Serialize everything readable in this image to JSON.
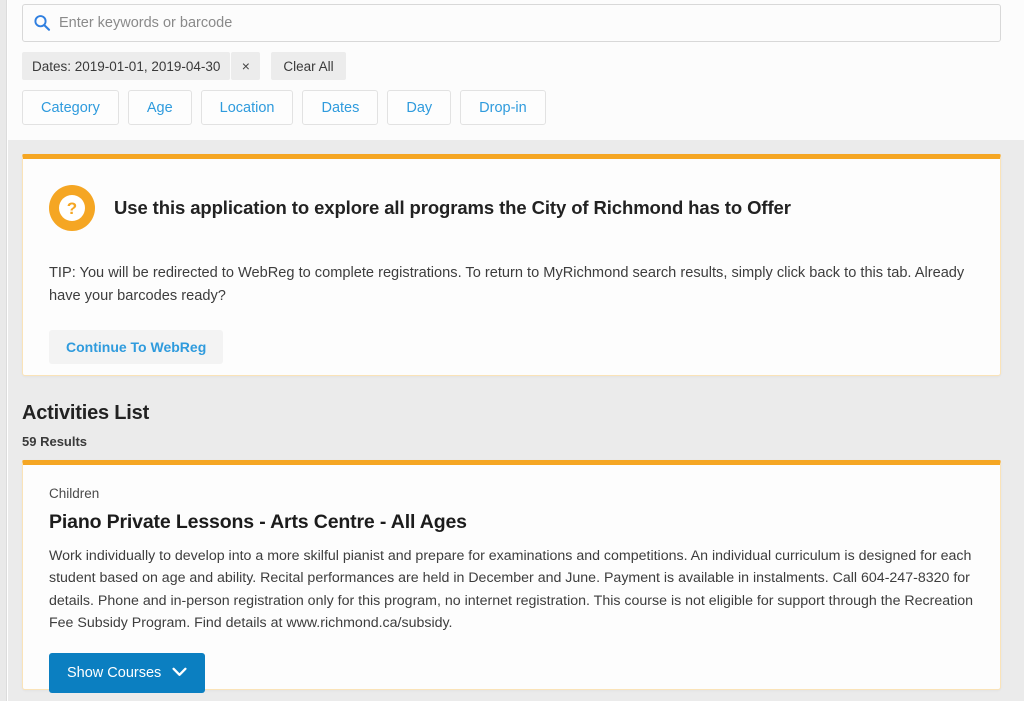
{
  "search": {
    "placeholder": "Enter keywords or barcode",
    "value": "",
    "icon": "search-icon"
  },
  "active_filters": {
    "chip_label": "Dates: 2019-01-01, 2019-04-30",
    "remove_icon": "×",
    "clear_all_label": "Clear All"
  },
  "filter_buttons": [
    {
      "label": "Category"
    },
    {
      "label": "Age"
    },
    {
      "label": "Location"
    },
    {
      "label": "Dates"
    },
    {
      "label": "Day"
    },
    {
      "label": "Drop-in"
    }
  ],
  "info_card": {
    "badge_icon": "question-mark-icon",
    "badge_glyph": "?",
    "title": "Use this application to explore all programs the City of Richmond has to Offer",
    "tip": "TIP: You will be redirected to WebReg to complete registrations. To return to MyRichmond search results, simply click back to this tab. Already have your barcodes ready?",
    "button_label": "Continue To WebReg"
  },
  "activities": {
    "heading": "Activities List",
    "results_count": "59 Results",
    "items": [
      {
        "category": "Children",
        "title": "Piano Private Lessons - Arts Centre - All Ages",
        "description": "Work individually to develop into a more skilful pianist and prepare for examinations and competitions. An individual curriculum is designed for each student based on age and ability. Recital performances are held in December and June. Payment is available in instalments. Call 604-247-8320 for details. Phone and in-person registration only for this program, no internet registration. This course is not eligible for support through the Recreation Fee Subsidy Program. Find details at www.richmond.ca/subsidy.",
        "action_label": "Show Courses",
        "action_icon": "chevron-down-icon"
      }
    ]
  },
  "colors": {
    "accent_orange": "#f5a623",
    "link_blue": "#2f9bdd",
    "primary_blue": "#0b7fc1",
    "page_gray": "#ebebeb"
  }
}
